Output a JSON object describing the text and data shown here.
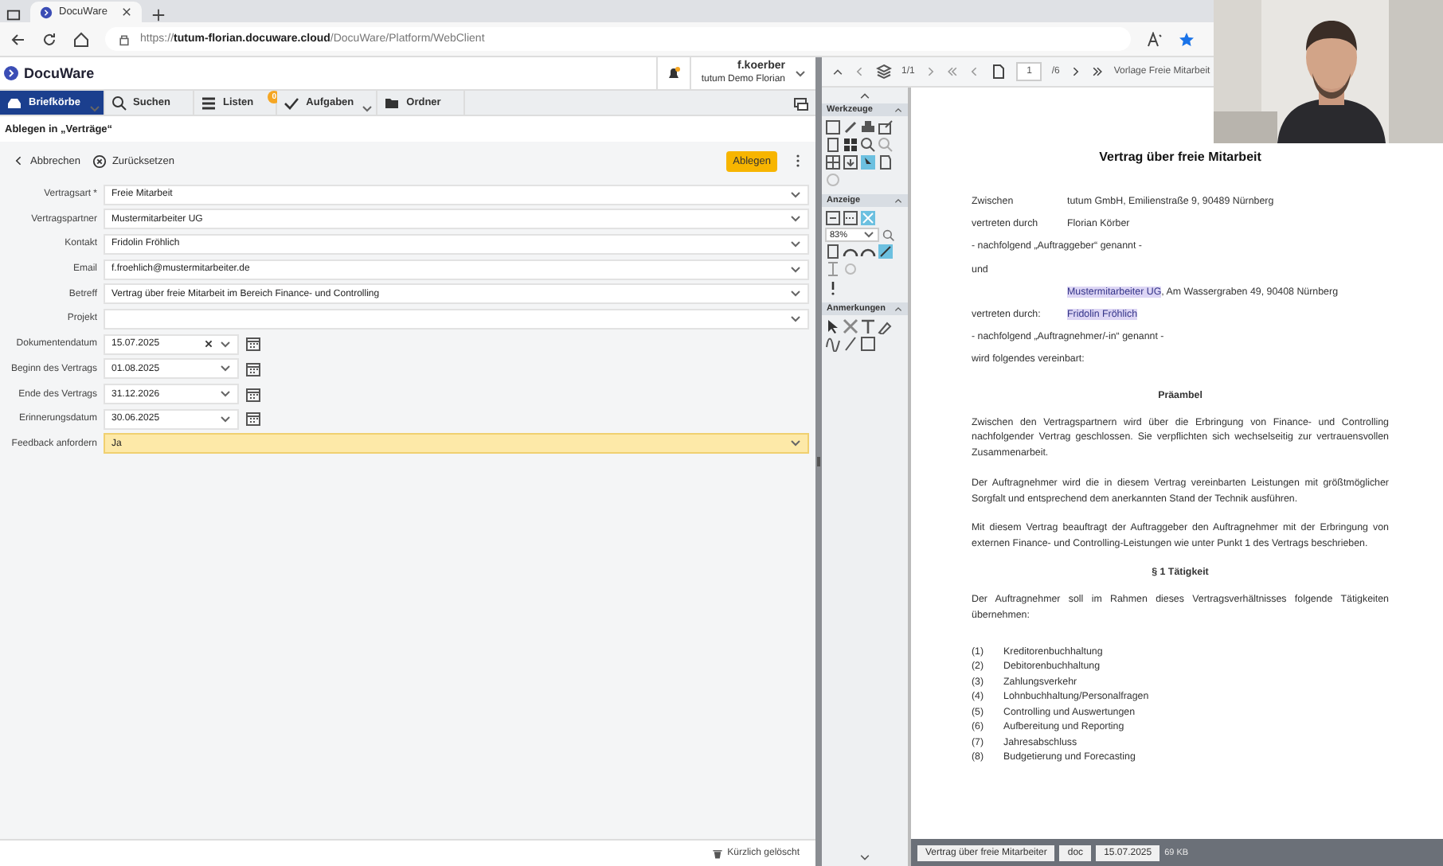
{
  "browser": {
    "tabs": [
      {
        "title": "DocuWare"
      }
    ],
    "url": "https://**tutum-florian.docuware.cloud**/DocuWare/Platform/WebClient"
  },
  "app": {
    "brand": "DocuWare",
    "user": {
      "name": "f.koerber",
      "org": "tutum Demo Florian"
    },
    "nav": [
      {
        "label": "Briefkörbe",
        "kind": "tray",
        "selected": true,
        "dropdown": true
      },
      {
        "label": "Suchen",
        "kind": "search",
        "selected": false,
        "dropdown": false
      },
      {
        "label": "Listen",
        "kind": "list",
        "selected": false,
        "dropdown": false,
        "badge": "0"
      },
      {
        "label": "Aufgaben",
        "kind": "check",
        "selected": false,
        "dropdown": true
      },
      {
        "label": "Ordner",
        "kind": "folder",
        "selected": false,
        "dropdown": false
      }
    ],
    "title": "Ablegen in „Verträge“",
    "toolbar": {
      "cancel": "Abbrechen",
      "reset": "Zurücksetzen",
      "submit": "Ablegen"
    },
    "fields": [
      {
        "label": "Vertragsart *",
        "value": "Freie Mitarbeit",
        "kind": "select",
        "focused": false
      },
      {
        "label": "Vertragspartner",
        "value": "Mustermitarbeiter UG",
        "kind": "select",
        "focused": false
      },
      {
        "label": "Kontakt",
        "value": "Fridolin Fröhlich",
        "kind": "select",
        "focused": false
      },
      {
        "label": "Email",
        "value": "f.froehlich@mustermitarbeiter.de",
        "kind": "select",
        "focused": false
      },
      {
        "label": "Betreff",
        "value": "Vertrag über freie Mitarbeit im Bereich Finance- und Controlling",
        "kind": "select",
        "focused": false
      },
      {
        "label": "Projekt",
        "kind": "select",
        "focused": false
      },
      {
        "label": "Dokumentendatum",
        "value": "15.07.2025",
        "kind": "date",
        "clearable": true,
        "focused": false
      },
      {
        "label": "Beginn des Vertrags",
        "value": "01.08.2025",
        "kind": "date",
        "clearable": false,
        "focused": false
      },
      {
        "label": "Ende des Vertrags",
        "value": "31.12.2026",
        "kind": "date",
        "clearable": false,
        "focused": false
      },
      {
        "label": "Erinnerungsdatum",
        "value": "30.06.2025",
        "kind": "date",
        "clearable": false,
        "focused": false
      },
      {
        "label": "Feedback anfordern",
        "value": "Ja",
        "kind": "select",
        "focused": true
      }
    ],
    "status": "Kürzlich gelöscht"
  },
  "viewer": {
    "toolbar": {
      "stack_page": "1/1",
      "page_input": "1",
      "page_total": "/6",
      "document_name": "Vorlage Freie Mitarbeit"
    },
    "palette": [
      {
        "title": "Werkzeuge",
        "kind": "tools"
      },
      {
        "title": "Anzeige",
        "kind": "view",
        "zoom": "83%"
      },
      {
        "title": "Anmerkungen",
        "kind": "annotations"
      }
    ],
    "document": [
      {
        "kind": "title",
        "text": "Vertrag über freie Mitarbeit"
      },
      {
        "kind": "party",
        "label": "Zwischen",
        "parts": [
          {
            "text": "tutum GmbH, Emilienstraße 9, 90489 Nürnberg",
            "highlighted": false
          }
        ]
      },
      {
        "kind": "party",
        "label": "vertreten durch",
        "parts": [
          {
            "text": "Florian Körber",
            "highlighted": false
          }
        ]
      },
      {
        "kind": "line",
        "text": "- nachfolgend „Auftraggeber“ genannt -"
      },
      {
        "kind": "line",
        "text": "und"
      },
      {
        "kind": "party",
        "parts": [
          {
            "text": "Mustermitarbeiter UG",
            "highlighted": true
          },
          {
            "text": ", Am Wassergraben 49, 90408 Nürnberg",
            "highlighted": false
          }
        ]
      },
      {
        "kind": "party",
        "label": "vertreten durch:",
        "parts": [
          {
            "text": "Fridolin Fröhlich",
            "highlighted": true
          }
        ]
      },
      {
        "kind": "line",
        "text": "- nachfolgend „Auftragnehmer/-in“ genannt -"
      },
      {
        "kind": "line",
        "text": "wird folgendes vereinbart:"
      },
      {
        "kind": "heading",
        "text": "Präambel"
      },
      {
        "kind": "para",
        "text": "Zwischen den Vertragspartnern wird über die Erbringung von Finance- und Controlling nachfolgender Vertrag geschlossen. Sie verpflichten sich wechselseitig zur vertrauensvollen Zusammenarbeit."
      },
      {
        "kind": "para",
        "text": "Der Auftragnehmer wird die in diesem Vertrag vereinbarten Leistungen mit größtmöglicher Sorgfalt und entsprechend dem anerkannten Stand der Technik ausführen."
      },
      {
        "kind": "para",
        "text": "Mit diesem Vertrag beauftragt der Auftraggeber den Auftragnehmer mit der Erbringung von externen Finance- und Controlling-Leistungen wie unter Punkt 1 des Vertrags beschrieben."
      },
      {
        "kind": "heading",
        "text": "§ 1 Tätigkeit"
      },
      {
        "kind": "para",
        "text": "Der Auftragnehmer soll im Rahmen dieses Vertragsverhältnisses folgende Tätigkeiten übernehmen:"
      },
      {
        "kind": "list",
        "items": [
          {
            "num": "(1)",
            "text": "Kreditorenbuchhaltung"
          },
          {
            "num": "(2)",
            "text": "Debitorenbuchhaltung"
          },
          {
            "num": "(3)",
            "text": "Zahlungsverkehr"
          },
          {
            "num": "(4)",
            "text": "Lohnbuchhaltung/Personalfragen"
          },
          {
            "num": "(5)",
            "text": "Controlling und Auswertungen"
          },
          {
            "num": "(6)",
            "text": "Aufbereitung und Reporting"
          },
          {
            "num": "(7)",
            "text": "Jahresabschluss"
          },
          {
            "num": "(8)",
            "text": "Budgetierung und Forecasting"
          }
        ]
      }
    ],
    "footer": {
      "chips": [
        "Vertrag über freie Mitarbeiter",
        "doc",
        "15.07.2025"
      ],
      "size": "69 KB"
    }
  }
}
